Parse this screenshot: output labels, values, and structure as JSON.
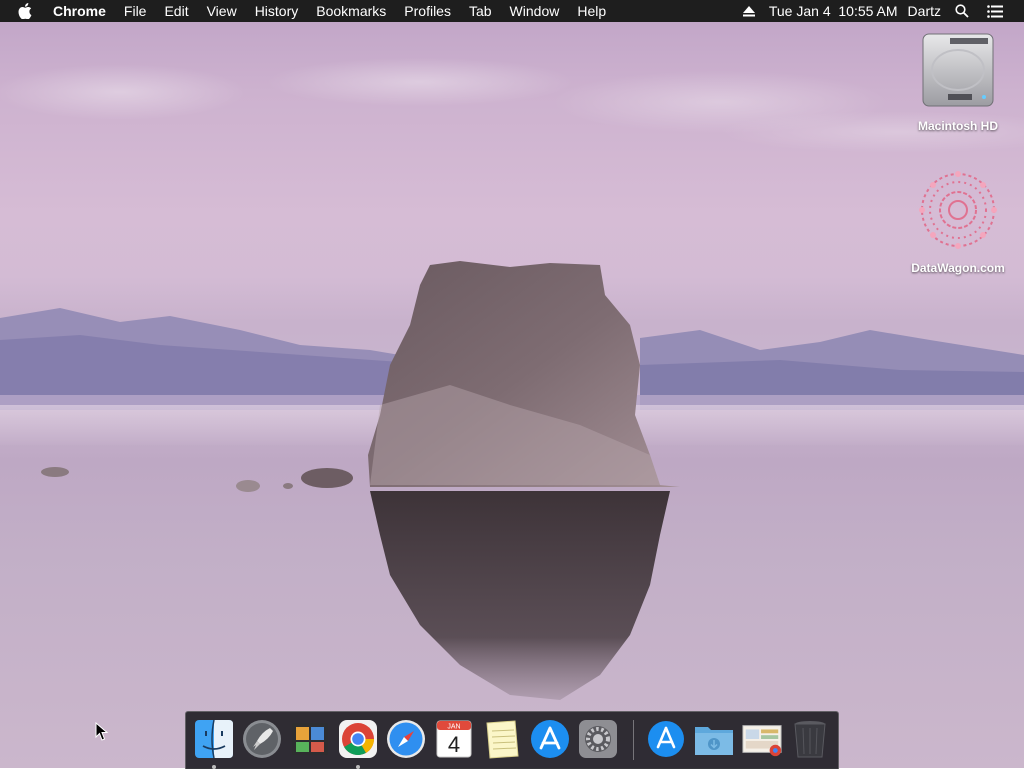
{
  "menubar": {
    "apple_icon": "apple-logo-icon",
    "app_name": "Chrome",
    "menus": [
      "File",
      "Edit",
      "View",
      "History",
      "Bookmarks",
      "Profiles",
      "Tab",
      "Window",
      "Help"
    ],
    "eject_icon": "eject-icon",
    "datetime": "Tue Jan 4  10:55 AM",
    "user": "Dartz",
    "search_icon": "spotlight-search-icon",
    "control_icon": "notification-center-icon"
  },
  "desktop": {
    "icons": [
      {
        "label": "Macintosh HD",
        "icon": "hard-drive-icon"
      },
      {
        "label": "DataWagon.com",
        "icon": "datawagon-logo-icon"
      }
    ]
  },
  "dock": {
    "items": [
      {
        "name": "Finder",
        "icon": "finder-icon",
        "running": true
      },
      {
        "name": "Launchpad",
        "icon": "launchpad-icon",
        "running": false
      },
      {
        "name": "Image Capture",
        "icon": "image-capture-icon",
        "running": false
      },
      {
        "name": "Google Chrome",
        "icon": "chrome-icon",
        "running": true
      },
      {
        "name": "Safari",
        "icon": "safari-icon",
        "running": false
      },
      {
        "name": "Calendar",
        "icon": "calendar-icon",
        "running": false,
        "month": "JAN",
        "day": "4"
      },
      {
        "name": "Notes",
        "icon": "notes-icon",
        "running": false
      },
      {
        "name": "App Store",
        "icon": "app-store-icon",
        "running": false
      },
      {
        "name": "System Preferences",
        "icon": "system-preferences-icon",
        "running": false
      },
      {
        "name": "Applications",
        "icon": "applications-folder-icon",
        "running": false
      },
      {
        "name": "Downloads",
        "icon": "downloads-folder-icon",
        "running": false
      },
      {
        "name": "Screenshot",
        "icon": "screenshot-thumbnail-icon",
        "running": false
      },
      {
        "name": "Trash",
        "icon": "trash-icon",
        "running": false
      }
    ]
  }
}
